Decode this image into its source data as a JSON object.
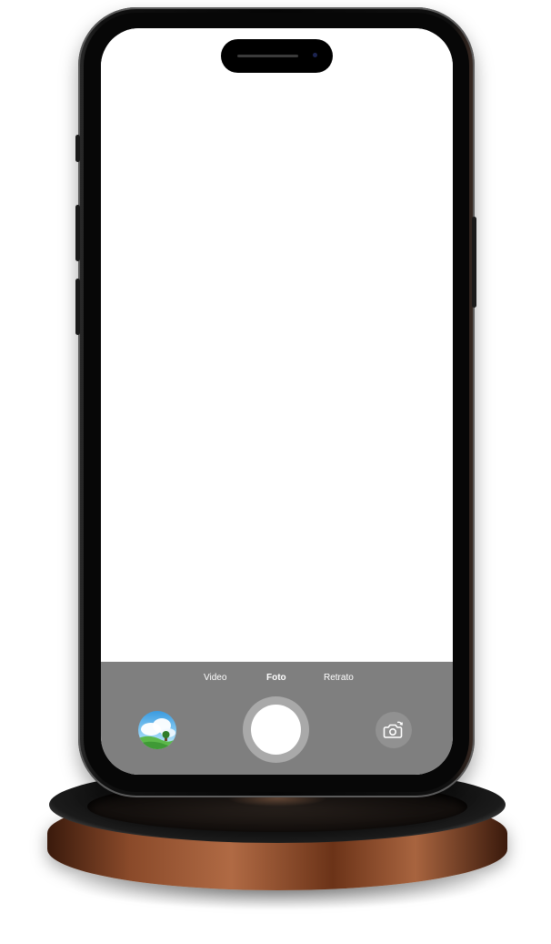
{
  "camera": {
    "modes": {
      "video": "Video",
      "photo": "Foto",
      "portrait": "Retrato"
    },
    "selected_mode": "Foto",
    "icons": {
      "gallery": "gallery-thumbnail-icon",
      "shutter": "shutter-button-icon",
      "switch": "flip-camera-icon"
    }
  },
  "colors": {
    "controls_bar": "#7f7f7f",
    "shutter_ring": "#a9a9a9",
    "shutter_inner": "#ffffff",
    "screen": "#ffffff"
  }
}
